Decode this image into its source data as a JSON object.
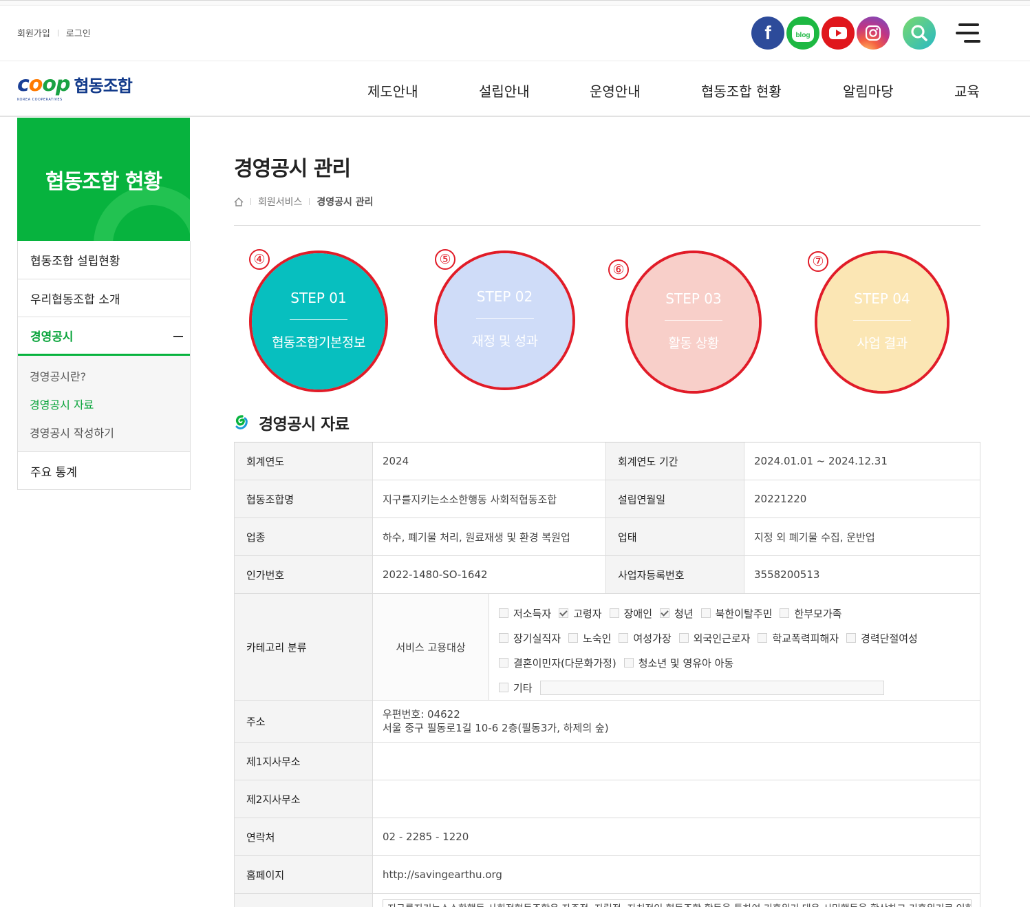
{
  "util": {
    "join": "회원가입",
    "login": "로그인"
  },
  "sns": {
    "facebook_glyph": "f",
    "blog_label": "blog"
  },
  "colors": {
    "facebook": "#2d4b9a",
    "blog": "#1db842",
    "youtube": "#e0161c",
    "instagram": "#c13584",
    "search": "#3ac2a4",
    "green": "#07b33e",
    "red_mark": "#e11c28"
  },
  "logo": {
    "word": "coop",
    "korean": "협동조합",
    "sub": "KOREA COOPERATIVES"
  },
  "gnb": [
    "제도안내",
    "설립안내",
    "운영안내",
    "협동조합 현황",
    "알림마당",
    "교육"
  ],
  "lnb": {
    "title": "협동조합 현황",
    "items": [
      "협동조합 설립현황",
      "우리협동조합 소개",
      "경영공시",
      "주요 통계"
    ],
    "sub": [
      "경영공시란?",
      "경영공시 자료",
      "경영공시 작성하기"
    ]
  },
  "page": {
    "title": "경영공시 관리",
    "breadcrumb": [
      "회원서비스",
      "경영공시 관리"
    ]
  },
  "steps": [
    {
      "no": "STEP 01",
      "label": "협동조합기본정보",
      "mark": "④",
      "color": "#07bfbf"
    },
    {
      "no": "STEP 02",
      "label": "재정 및 성과",
      "mark": "⑤",
      "color": "#cfdcf8"
    },
    {
      "no": "STEP 03",
      "label": "활동 상황",
      "mark": "⑥",
      "color": "#f8cfc9"
    },
    {
      "no": "STEP 04",
      "label": "사업 결과",
      "mark": "⑦",
      "color": "#fbe6b4"
    }
  ],
  "section_title": "경영공시 자료",
  "table": {
    "fiscal_year_label": "회계연도",
    "fiscal_year": "2024",
    "fiscal_period_label": "회계연도 기간",
    "fiscal_period": "2024.01.01 ~ 2024.12.31",
    "coop_name_label": "협동조합명",
    "coop_name": "지구를지키는소소한행동 사회적협동조합",
    "founded_label": "설립연월일",
    "founded": "20221220",
    "industry_label": "업종",
    "industry": "하수, 폐기물 처리, 원료재생 및 환경 복원업",
    "business_label": "업태",
    "business": "지정 외 폐기물 수집, 운반업",
    "permit_label": "인가번호",
    "permit": "2022-1480-SO-1642",
    "bizreg_label": "사업자등록번호",
    "bizreg": "3558200513",
    "category_label": "카테고리 분류",
    "service_label": "서비스 고용대상",
    "checkbox_rows": [
      [
        {
          "label": "저소득자",
          "checked": false
        },
        {
          "label": "고령자",
          "checked": true
        },
        {
          "label": "장애인",
          "checked": false
        },
        {
          "label": "청년",
          "checked": true
        },
        {
          "label": "북한이탈주민",
          "checked": false
        },
        {
          "label": "한부모가족",
          "checked": false
        }
      ],
      [
        {
          "label": "장기실직자",
          "checked": false
        },
        {
          "label": "노숙인",
          "checked": false
        },
        {
          "label": "여성가장",
          "checked": false
        },
        {
          "label": "외국인근로자",
          "checked": false
        },
        {
          "label": "학교폭력피해자",
          "checked": false
        },
        {
          "label": "경력단절여성",
          "checked": false
        }
      ],
      [
        {
          "label": "결혼이민자(다문화가정)",
          "checked": false
        },
        {
          "label": "청소년 및 영유아 아동",
          "checked": false
        }
      ]
    ],
    "etc_label": "기타",
    "address_label": "주소",
    "postal": "우편번호: 04622",
    "address": "서울 중구 필동로1길 10-6  2층(필동3가, 하제의 숲)",
    "branch1_label": "제1지사무소",
    "branch2_label": "제2지사무소",
    "contact_label": "연락처",
    "contact": "02 - 2285 - 1220",
    "homepage_label": "홈페이지",
    "homepage": "http://savingearthu.org",
    "intro_partial": "지구를지키는소소한행동 사회적협동조합은 자주적, 자립적, 자치적인 협동조합 활동을 통하여 기후위기 대응 시민행동을 확산하고 기후위기로 인한 환경사회"
  }
}
